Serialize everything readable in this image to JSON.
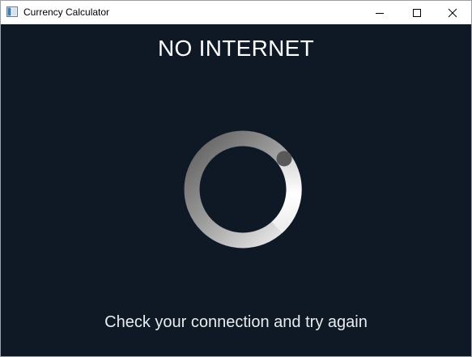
{
  "window": {
    "title": "Currency Calculator",
    "app_icon": "window-app-icon",
    "controls": {
      "minimize_icon": "minimize-icon",
      "maximize_icon": "maximize-icon",
      "close_icon": "close-icon"
    }
  },
  "main": {
    "heading": "NO INTERNET",
    "message": "Check your connection and try again",
    "spinner_icon": "loading-spinner-icon"
  },
  "colors": {
    "background": "#0f1926",
    "text": "#ffffff",
    "spinner_light": "#f2f2f2",
    "spinner_dark": "#6a6a6a"
  }
}
